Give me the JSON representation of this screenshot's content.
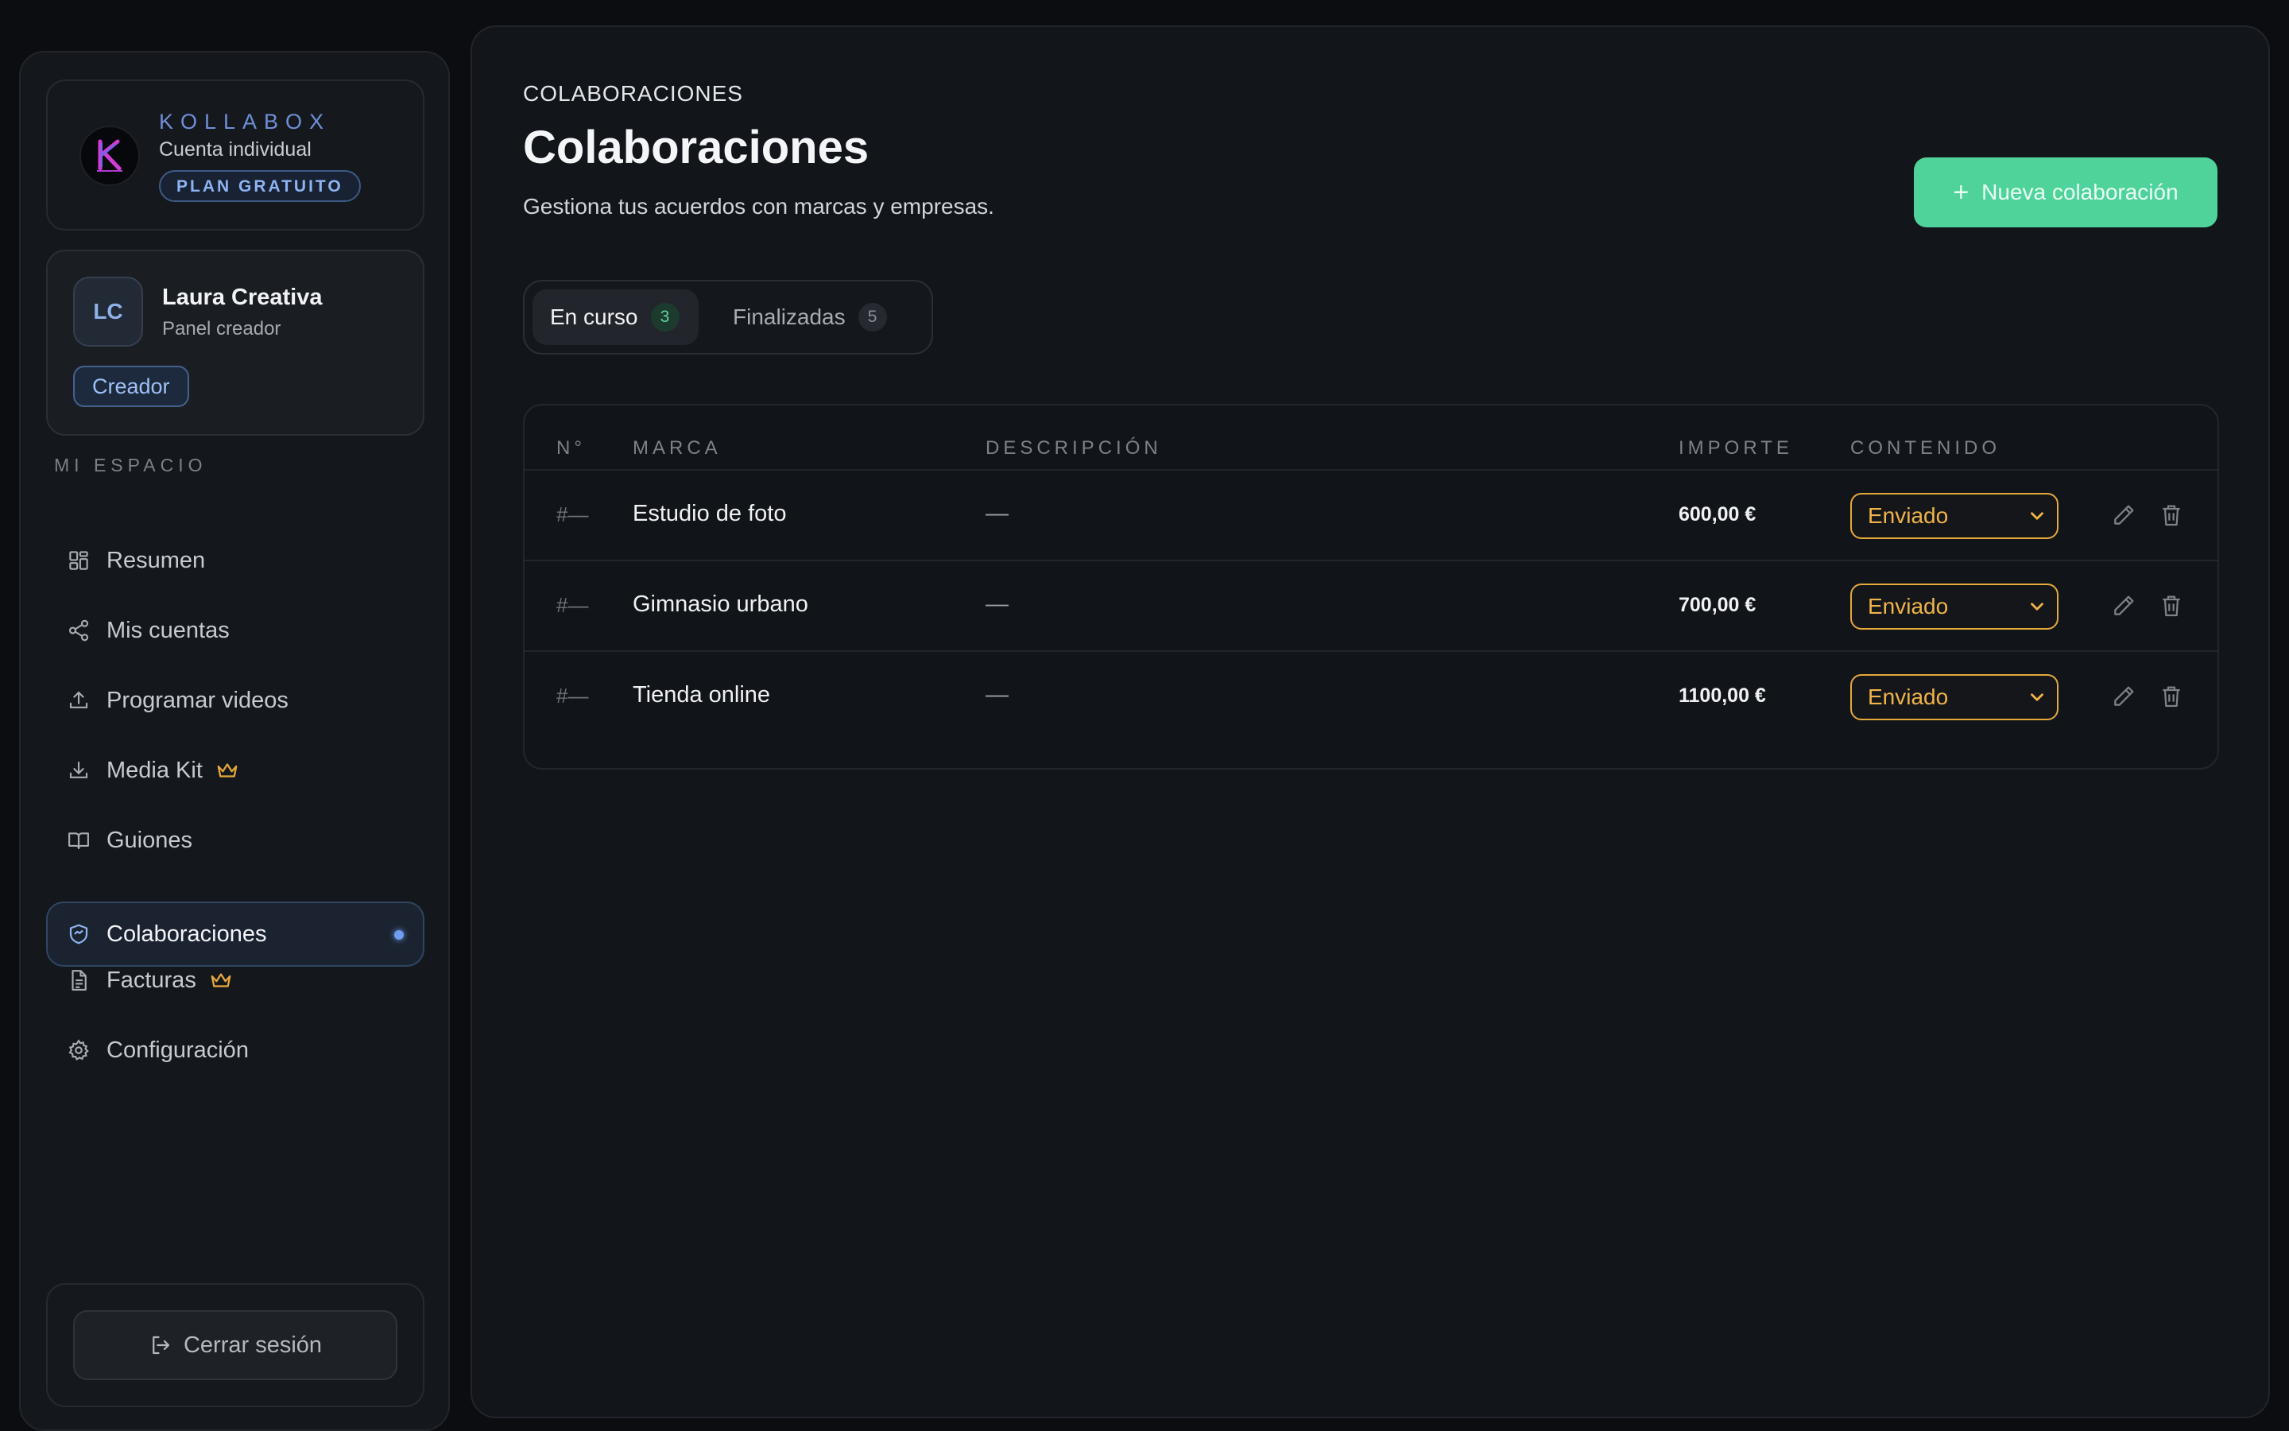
{
  "brand": {
    "name": "KOLLABOX",
    "account_type": "Cuenta individual",
    "plan": "PLAN GRATUITO"
  },
  "user": {
    "initials": "LC",
    "name": "Laura Creativa",
    "panel": "Panel creador",
    "role_badge": "Creador"
  },
  "sidebar": {
    "section_label": "MI ESPACIO",
    "items": [
      {
        "label": "Resumen",
        "icon": "grid-icon"
      },
      {
        "label": "Mis cuentas",
        "icon": "share-icon"
      },
      {
        "label": "Programar videos",
        "icon": "upload-icon"
      },
      {
        "label": "Media Kit",
        "icon": "download-icon",
        "premium": true
      },
      {
        "label": "Guiones",
        "icon": "book-icon"
      },
      {
        "label": "Colaboraciones",
        "icon": "handshake-icon",
        "active": true
      },
      {
        "label": "Facturas",
        "icon": "document-icon",
        "premium": true
      },
      {
        "label": "Configuración",
        "icon": "gear-icon"
      }
    ],
    "logout_label": "Cerrar sesión"
  },
  "main": {
    "eyebrow": "COLABORACIONES",
    "title": "Colaboraciones",
    "description": "Gestiona tus acuerdos con marcas y empresas.",
    "new_button": "Nueva colaboración",
    "tabs": [
      {
        "label": "En curso",
        "count": "3",
        "active": true
      },
      {
        "label": "Finalizadas",
        "count": "5",
        "active": false
      }
    ],
    "table": {
      "headers": {
        "num": "N°",
        "brand": "MARCA",
        "description": "DESCRIPCIÓN",
        "amount": "IMPORTE",
        "content": "CONTENIDO"
      },
      "rows": [
        {
          "num": "#—",
          "brand": "Estudio de foto",
          "description": "—",
          "amount": "600,00 €",
          "status": "Enviado"
        },
        {
          "num": "#—",
          "brand": "Gimnasio urbano",
          "description": "—",
          "amount": "700,00 €",
          "status": "Enviado"
        },
        {
          "num": "#—",
          "brand": "Tienda online",
          "description": "—",
          "amount": "1100,00 €",
          "status": "Enviado"
        }
      ]
    }
  },
  "colors": {
    "accent_green": "#4fd39a",
    "accent_blue": "#6f8fd8",
    "status_orange": "#e6a93a",
    "crown_gold": "#e8a93a"
  }
}
